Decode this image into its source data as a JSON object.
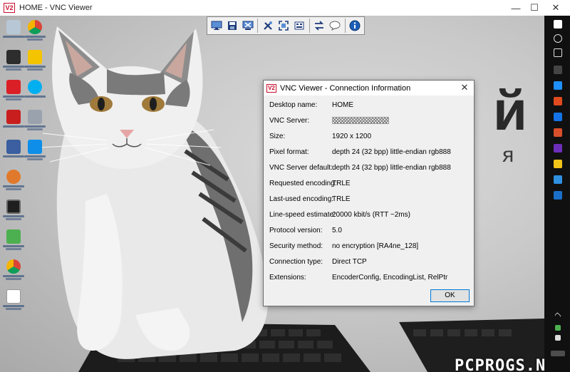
{
  "window": {
    "logo": "V2",
    "title": "HOME - VNC Viewer",
    "minimize": "—",
    "maximize": "☐",
    "close": "✕"
  },
  "toolbar": {
    "buttons": [
      {
        "icon": "monitor-icon"
      },
      {
        "icon": "save-icon"
      },
      {
        "icon": "disconnect-icon"
      },
      {
        "icon": "options-icon"
      },
      {
        "icon": "fullscreen-icon"
      },
      {
        "icon": "ctrl-alt-del-icon"
      },
      {
        "icon": "transfer-icon"
      },
      {
        "icon": "chat-icon"
      },
      {
        "icon": "info-icon"
      }
    ]
  },
  "dialog": {
    "logo": "V2",
    "title": "VNC Viewer - Connection Information",
    "close": "✕",
    "rows": [
      {
        "label": "Desktop name:",
        "value": "HOME"
      },
      {
        "label": "VNC Server:",
        "value": ""
      },
      {
        "label": "Size:",
        "value": "1920 x 1200"
      },
      {
        "label": "Pixel format:",
        "value": "depth 24 (32 bpp) little-endian rgb888"
      },
      {
        "label": "VNC Server default:",
        "value": "depth 24 (32 bpp) little-endian rgb888"
      },
      {
        "label": "Requested encoding:",
        "value": "TRLE"
      },
      {
        "label": "Last-used encoding:",
        "value": "TRLE"
      },
      {
        "label": "Line-speed estimate:",
        "value": "20000 kbit/s (RTT ~2ms)"
      },
      {
        "label": "Protocol version:",
        "value": "5.0"
      },
      {
        "label": "Security method:",
        "value": "no encryption [RA4ne_128]"
      },
      {
        "label": "Connection type:",
        "value": "Direct TCP"
      },
      {
        "label": "Extensions:",
        "value": "EncoderConfig, EncodingList, RelPtr"
      }
    ],
    "ok_label": "OK"
  },
  "wallpaper_text": {
    "big": "й ?",
    "small": "я"
  },
  "watermark": "PCPROGS.NET",
  "colors": {
    "accent": "#0078d7",
    "brand": "#c8102e"
  }
}
